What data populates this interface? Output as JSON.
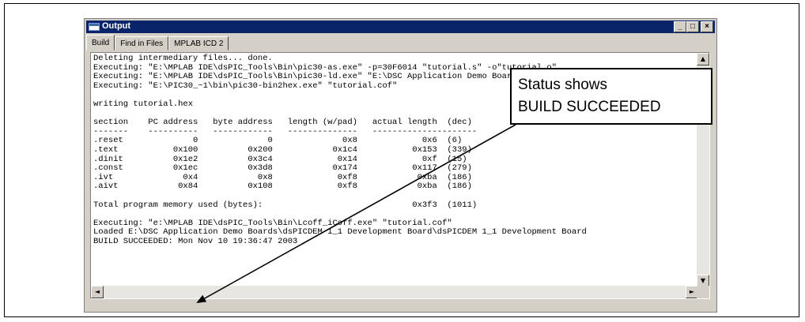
{
  "window": {
    "title": "Output",
    "controls": [
      "_",
      "□",
      "×"
    ]
  },
  "tabs": [
    {
      "label": "Build",
      "active": true
    },
    {
      "label": "Find in Files",
      "active": false
    },
    {
      "label": "MPLAB ICD 2",
      "active": false
    }
  ],
  "output_lines": [
    "Deleting intermediary files... done.",
    "Executing: \"E:\\MPLAB IDE\\dsPIC_Tools\\Bin\\pic30-as.exe\" -p=30F6014 \"tutorial.s\" -o\"tutorial.o\"",
    "Executing: \"E:\\MPLAB IDE\\dsPIC_Tools\\Bin\\pic30-ld.exe\" \"E:\\DSC Application Demo Boards\\tutorial.o\"",
    "Executing: \"E:\\PIC30_~1\\bin\\pic30-bin2hex.exe\" \"tutorial.cof\"",
    "",
    "writing tutorial.hex",
    "",
    "section    PC address   byte address   length (w/pad)   actual length  (dec)",
    "-------    ----------   ------------   --------------   ---------------------",
    ".reset              0              0              0x8             0x6  (6)",
    ".text           0x100          0x200            0x1c4           0x153  (339)",
    ".dinit          0x1e2          0x3c4             0x14             0xf  (15)",
    ".const          0x1ec          0x3d8            0x174           0x117  (279)",
    ".ivt              0x4            0x8             0xf8            0xba  (186)",
    ".aivt            0x84          0x108             0xf8            0xba  (186)",
    "",
    "Total program memory used (bytes):                              0x3f3  (1011)",
    "",
    "Executing: \"e:\\MPLAB IDE\\dsPIC_Tools\\Bin\\Lcoff_iCoff.exe\" \"tutorial.cof\"",
    "Loaded E:\\DSC Application Demo Boards\\dsPICDEM 1_1 Development Board\\dsPICDEM 1_1 Development Board",
    "BUILD SUCCEEDED: Mon Nov 10 19:36:47 2003"
  ],
  "scrollbar": {
    "up": "▲",
    "down": "▼",
    "left": "◄",
    "right": "►"
  },
  "callout": {
    "line1": "Status shows",
    "line2": "BUILD SUCCEEDED"
  }
}
